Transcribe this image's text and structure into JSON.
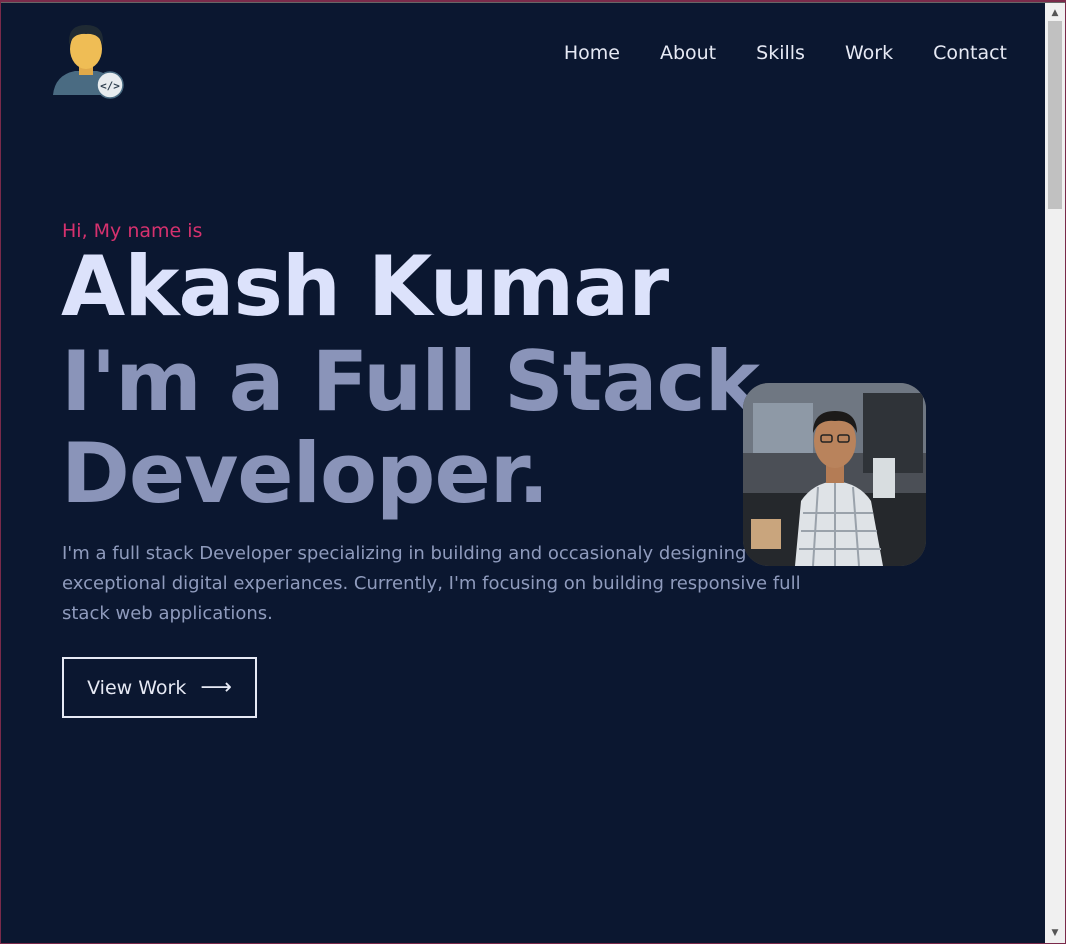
{
  "nav": {
    "items": [
      {
        "label": "Home"
      },
      {
        "label": "About"
      },
      {
        "label": "Skills"
      },
      {
        "label": "Work"
      },
      {
        "label": "Contact"
      }
    ]
  },
  "hero": {
    "greeting": "Hi, My name is",
    "name": "Akash Kumar",
    "role": "I'm a Full Stack Developer.",
    "intro": "I'm a full stack Developer specializing in building and occasionaly designing exceptional digital experiances. Currently, I'm focusing on building responsive full stack web applications.",
    "cta_label": "View Work",
    "cta_icon": "arrow-right-icon"
  },
  "colors": {
    "background": "#0b1730",
    "accent": "#d6316e",
    "heading": "#dce2fb",
    "subheading": "#8a94b9"
  },
  "scrollbar": {
    "up_icon": "scroll-up-arrow-icon",
    "down_icon": "scroll-down-arrow-icon"
  }
}
